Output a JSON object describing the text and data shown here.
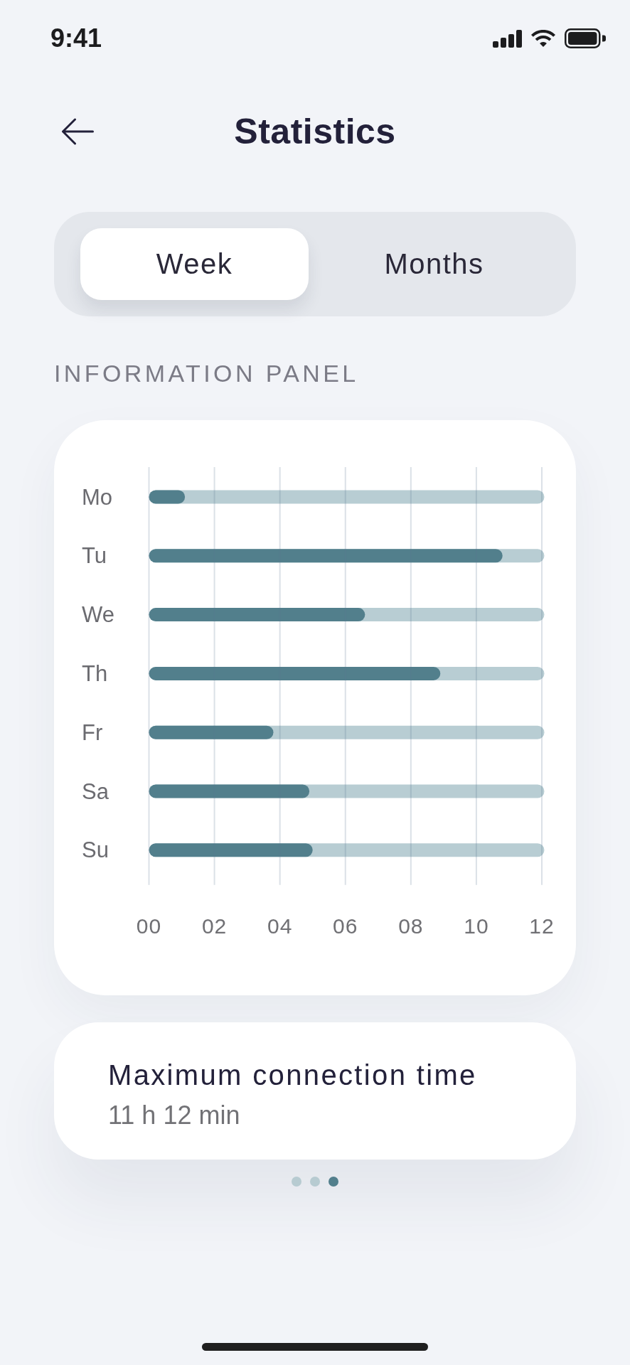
{
  "status_bar": {
    "time": "9:41"
  },
  "header": {
    "title": "Statistics"
  },
  "segmented_control": {
    "options": [
      {
        "label": "Week",
        "selected": true
      },
      {
        "label": "Months",
        "selected": false
      }
    ]
  },
  "information_panel": {
    "heading": "INFORMATION PANEL",
    "chart_data": {
      "type": "bar",
      "orientation": "horizontal",
      "grid": true,
      "categories": [
        "Mo",
        "Tu",
        "We",
        "Th",
        "Fr",
        "Sa",
        "Su"
      ],
      "values": [
        1.1,
        10.8,
        6.6,
        8.9,
        3.8,
        4.9,
        5.0
      ],
      "xlim": [
        0,
        12
      ],
      "xticks": [
        {
          "value": 0,
          "label": "00"
        },
        {
          "value": 2,
          "label": "02"
        },
        {
          "value": 4,
          "label": "04"
        },
        {
          "value": 6,
          "label": "06"
        },
        {
          "value": 8,
          "label": "08"
        },
        {
          "value": 10,
          "label": "10"
        },
        {
          "value": 12,
          "label": "12"
        }
      ]
    }
  },
  "summary_card": {
    "title": "Maximum connection time",
    "value": "11 h 12 min"
  },
  "page_indicator": [
    {
      "selected": false
    },
    {
      "selected": false
    },
    {
      "selected": true
    }
  ]
}
